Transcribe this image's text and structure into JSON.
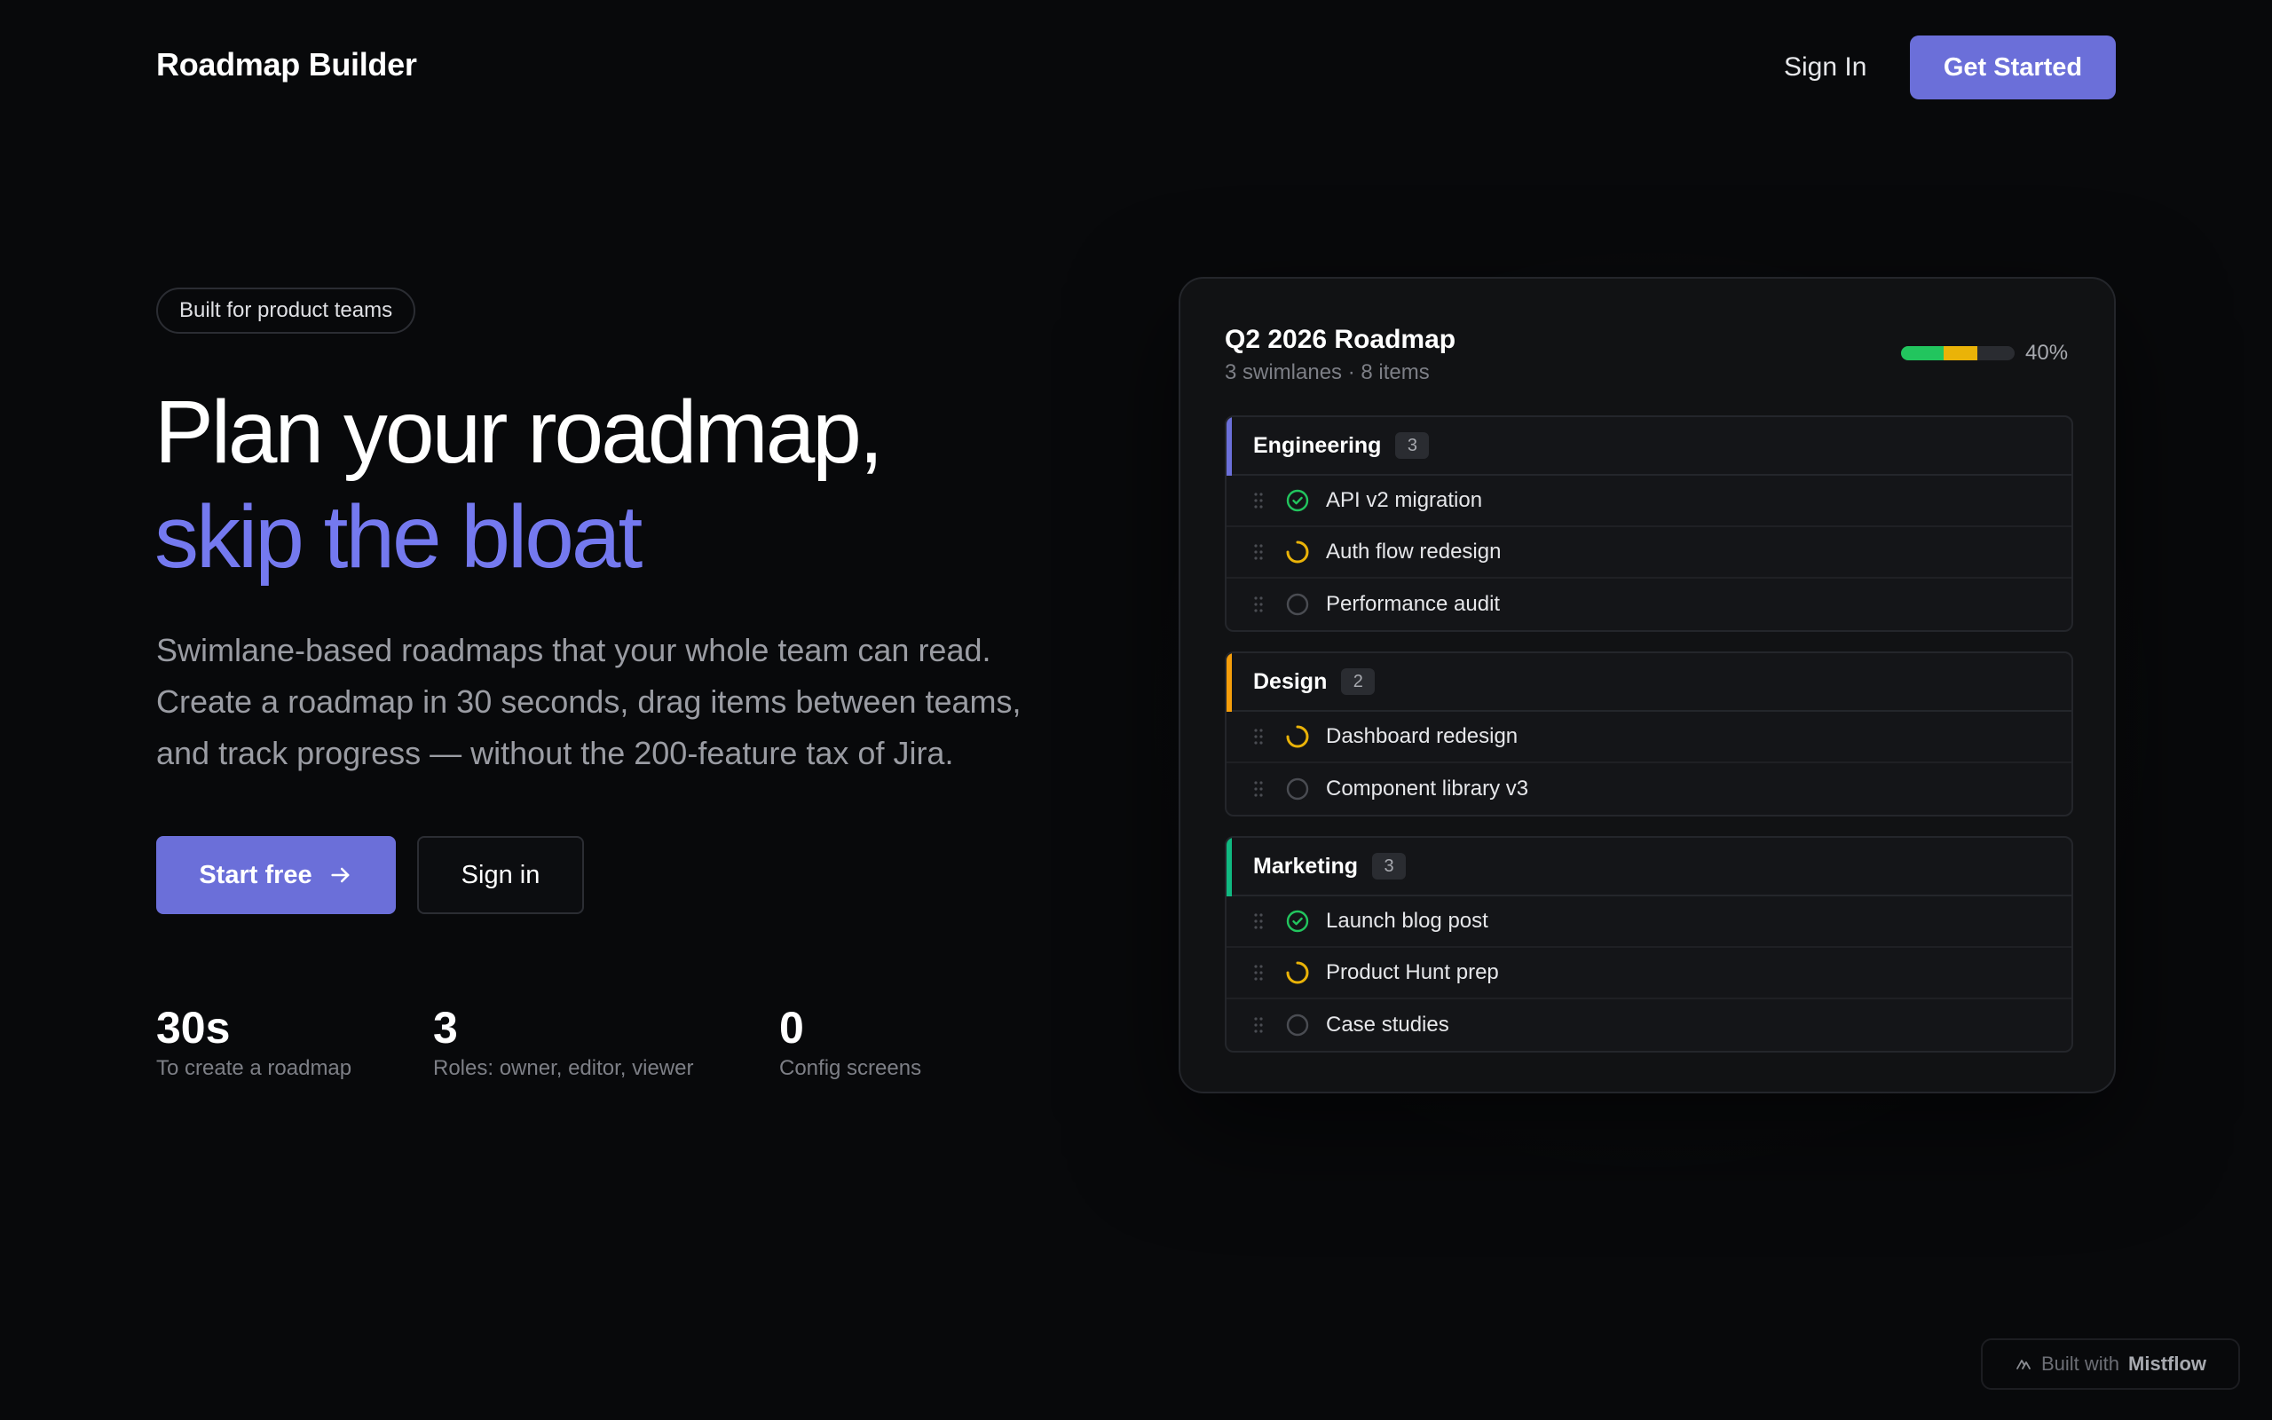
{
  "header": {
    "brand": "Roadmap Builder",
    "sign_in": "Sign In",
    "get_started": "Get Started"
  },
  "hero": {
    "badge": "Built for product teams",
    "headline_line1": "Plan your roadmap,",
    "headline_line2": "skip the bloat",
    "description": "Swimlane-based roadmaps that your whole team can read. Create a roadmap in 30 seconds, drag items between teams, and track progress — without the 200-feature tax of Jira.",
    "primary_cta": "Start free",
    "secondary_cta": "Sign in",
    "stats": [
      {
        "value": "30s",
        "label": "To create a roadmap"
      },
      {
        "value": "3",
        "label": "Roles: owner, editor, viewer"
      },
      {
        "value": "0",
        "label": "Config screens"
      }
    ]
  },
  "roadmap_card": {
    "title": "Q2 2026 Roadmap",
    "subtitle": "3 swimlanes · 8 items",
    "progress_label": "40%",
    "progress": {
      "done": 0.375,
      "in_progress": 0.3
    },
    "lanes": [
      {
        "name": "Engineering",
        "count": "3",
        "color": "#6b6fd9",
        "items": [
          {
            "label": "API v2 migration",
            "status": "done"
          },
          {
            "label": "Auth flow redesign",
            "status": "in-progress"
          },
          {
            "label": "Performance audit",
            "status": "todo"
          }
        ]
      },
      {
        "name": "Design",
        "count": "2",
        "color": "#f59e0b",
        "items": [
          {
            "label": "Dashboard redesign",
            "status": "in-progress"
          },
          {
            "label": "Component library v3",
            "status": "todo"
          }
        ]
      },
      {
        "name": "Marketing",
        "count": "3",
        "color": "#10b981",
        "items": [
          {
            "label": "Launch blog post",
            "status": "done"
          },
          {
            "label": "Product Hunt prep",
            "status": "in-progress"
          },
          {
            "label": "Case studies",
            "status": "todo"
          }
        ]
      }
    ]
  },
  "footer": {
    "built_with": "Built with",
    "built_with_brand": "Mistflow"
  },
  "colors": {
    "accent": "#6b6fd9",
    "accent_text": "#7479ef",
    "done": "#22c55e",
    "in_progress": "#eab308",
    "background": "#08090b"
  }
}
